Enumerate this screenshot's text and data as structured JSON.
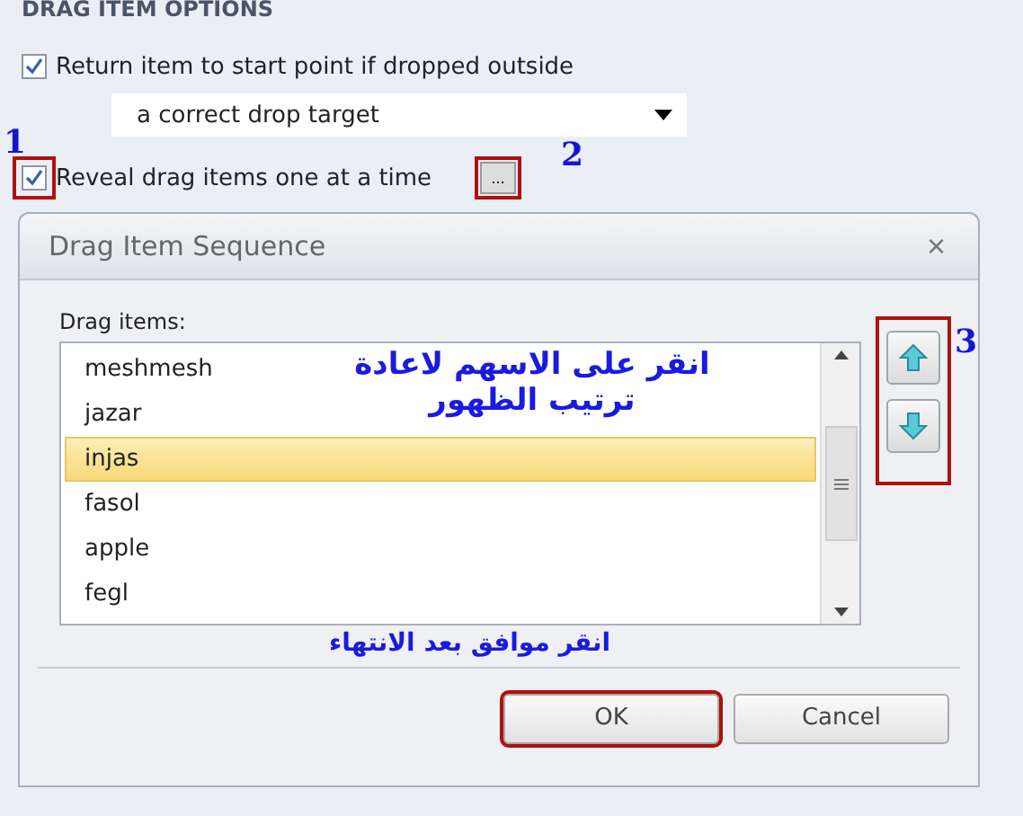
{
  "section_title": "DRAG ITEM OPTIONS",
  "options": [
    {
      "kind": "checkbox",
      "label": "Return item to start point if dropped outside",
      "checked": true
    },
    {
      "kind": "dropdown",
      "value": "a correct drop target"
    },
    {
      "kind": "checkbox",
      "label": "Reveal drag items one at a time",
      "checked": true,
      "marker": "1",
      "button": "..."
    }
  ],
  "button_marker": "2",
  "dialog": {
    "title": "Drag Item Sequence",
    "close": "×",
    "list_label": "Drag items:",
    "items": [
      {
        "label": "meshmesh",
        "selected": false
      },
      {
        "label": "jazar",
        "selected": false
      },
      {
        "label": "injas",
        "selected": true
      },
      {
        "label": "fasol",
        "selected": false
      },
      {
        "label": "apple",
        "selected": false
      },
      {
        "label": "fegl",
        "selected": false
      }
    ],
    "arrows_marker": "3",
    "note_arrows": "انقر على الاسهم لاعادة ترتيب الظهور",
    "note_ok": "انقر موافق بعد الانتهاء",
    "buttons": [
      {
        "label": "OK",
        "highlighted": true
      },
      {
        "label": "Cancel",
        "highlighted": false
      }
    ]
  }
}
